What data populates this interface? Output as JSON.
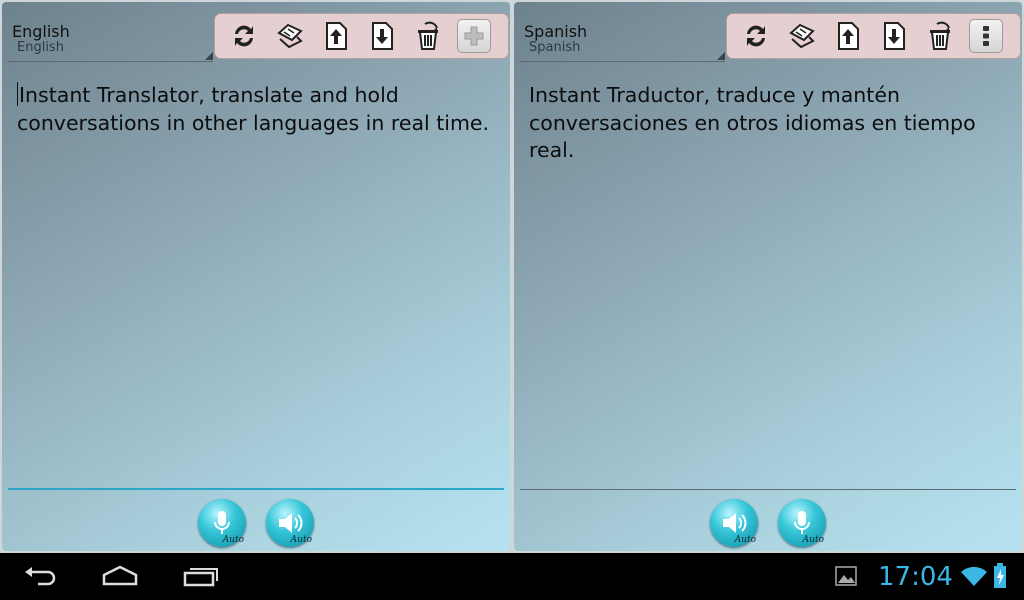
{
  "left_panel": {
    "language_name": "English",
    "language_sub": "English",
    "text": "Instant Translator, translate and hold conversations in other languages in real time.",
    "toolbar": [
      "refresh-icon",
      "swap-languages-icon",
      "upload-icon",
      "download-icon",
      "delete-icon",
      "add-icon"
    ],
    "buttons": [
      {
        "name": "microphone-icon",
        "label": "Auto"
      },
      {
        "name": "speaker-icon",
        "label": "Auto"
      }
    ]
  },
  "right_panel": {
    "language_name": "Spanish",
    "language_sub": "Spanish",
    "text": "Instant Traductor, traduce y mantén conversaciones en otros idiomas en tiempo real.",
    "toolbar": [
      "refresh-icon",
      "swap-languages-icon",
      "upload-icon",
      "download-icon",
      "delete-icon",
      "overflow-menu-icon"
    ],
    "buttons": [
      {
        "name": "speaker-icon",
        "label": "Auto"
      },
      {
        "name": "microphone-icon",
        "label": "Auto"
      }
    ]
  },
  "system_bar": {
    "time": "17:04",
    "icons": [
      "back-icon",
      "home-icon",
      "recent-apps-icon",
      "gallery-notification-icon",
      "wifi-icon",
      "battery-charging-icon"
    ]
  },
  "colors": {
    "accent": "#3bb6e5",
    "toolbar_bg": "#e6cfd0",
    "round_button": "#37c6d9"
  }
}
